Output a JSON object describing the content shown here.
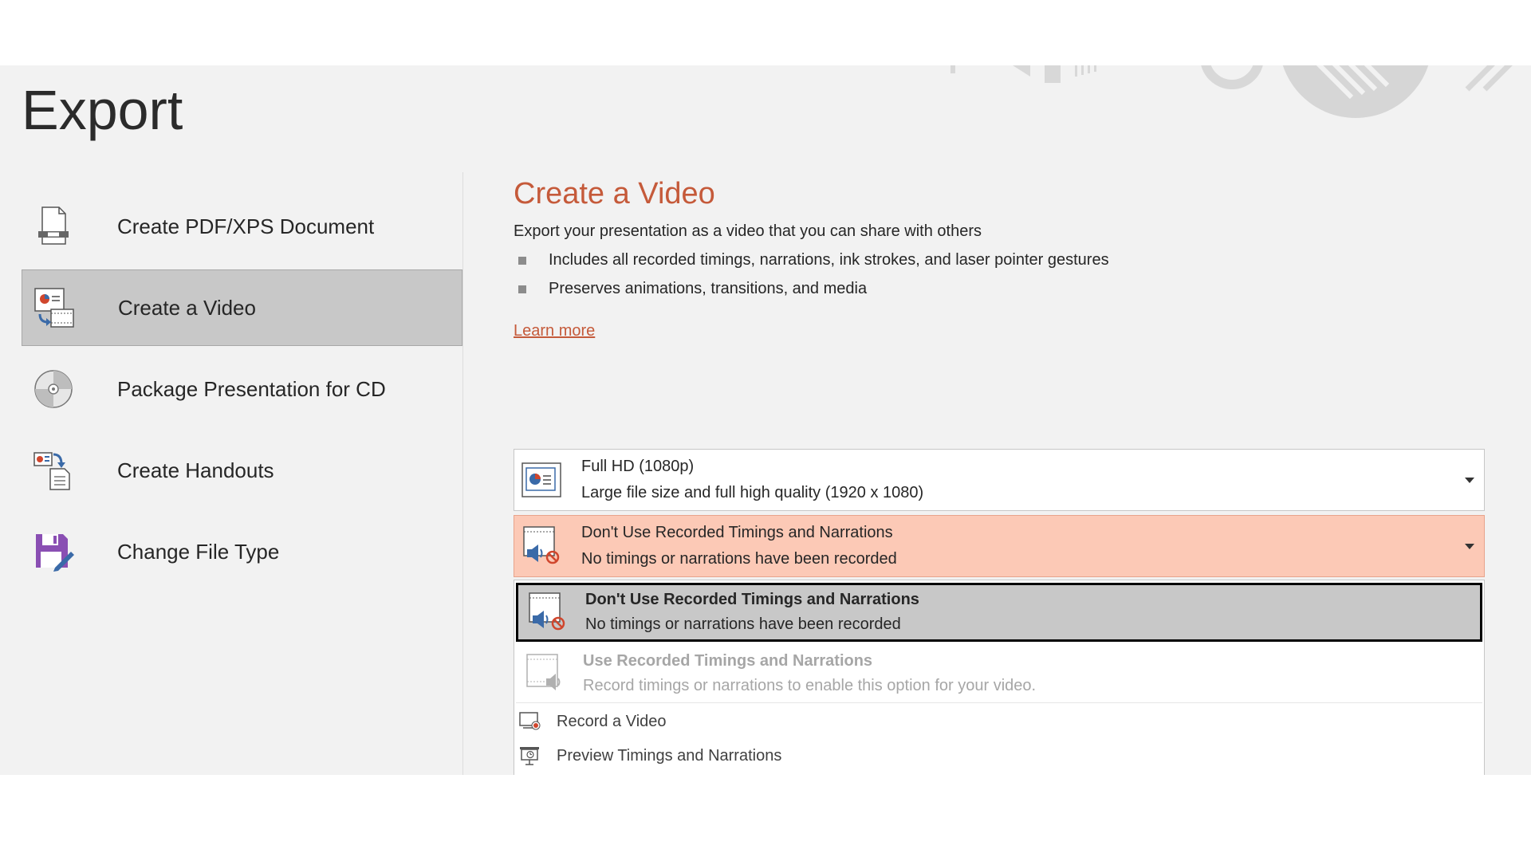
{
  "page": {
    "title": "Export"
  },
  "nav": {
    "items": [
      {
        "label": "Create PDF/XPS Document",
        "icon": "pdf-document-icon",
        "selected": false
      },
      {
        "label": "Create a Video",
        "icon": "video-icon",
        "selected": true
      },
      {
        "label": "Package Presentation for CD",
        "icon": "cd-icon",
        "selected": false
      },
      {
        "label": "Create Handouts",
        "icon": "handouts-icon",
        "selected": false
      },
      {
        "label": "Change File Type",
        "icon": "save-file-icon",
        "selected": false
      }
    ]
  },
  "panel": {
    "title": "Create a Video",
    "description": "Export your presentation as a video that you can share with others",
    "bullets": [
      "Includes all recorded timings, narrations, ink strokes, and laser pointer gestures",
      "Preserves animations, transitions, and media"
    ],
    "learn_more": "Learn more",
    "quality_dropdown": {
      "title": "Full HD (1080p)",
      "subtitle": "Large file size and full high quality (1920 x 1080)",
      "icon": "presentation-quality-icon"
    },
    "timing_dropdown": {
      "title": "Don't Use Recorded Timings and Narrations",
      "subtitle": "No timings or narrations have been recorded",
      "icon": "no-narration-icon"
    },
    "timing_menu": {
      "options": [
        {
          "title": "Don't Use Recorded Timings and Narrations",
          "subtitle": "No timings or narrations have been recorded",
          "selected": true,
          "enabled": true
        },
        {
          "title": "Use Recorded Timings and Narrations",
          "subtitle": "Record timings or narrations to enable this option for your video.",
          "selected": false,
          "enabled": false
        }
      ],
      "actions": [
        {
          "label": "Record a Video",
          "icon": "record-video-icon"
        },
        {
          "label": "Preview Timings and Narrations",
          "icon": "preview-timings-icon"
        }
      ]
    }
  },
  "colors": {
    "accent": "#c55a3a",
    "selected_nav_bg": "#c8c8c8",
    "highlight_dropdown_bg": "#fcc9b6",
    "background": "#f2f2f2"
  }
}
